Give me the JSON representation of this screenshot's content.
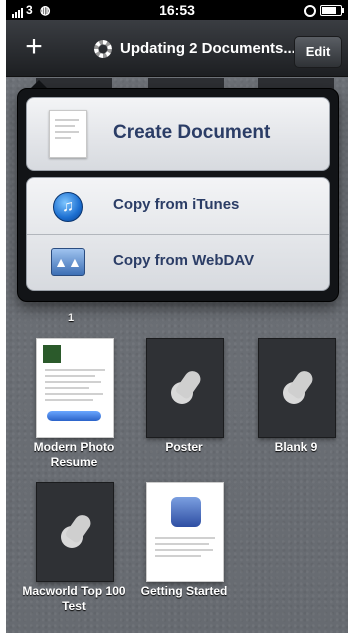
{
  "status_bar": {
    "carrier": "3",
    "time": "16:53"
  },
  "nav": {
    "add_label": "+",
    "title": "Updating 2 Documents...",
    "edit_label": "Edit"
  },
  "menu": {
    "create_document": "Create Document",
    "copy_itunes": "Copy from iTunes",
    "copy_webdav": "Copy from WebDAV"
  },
  "documents": [
    {
      "name": "Modern Photo Resume",
      "icon": "document-thumbnail"
    },
    {
      "name": "Poster",
      "icon": "pages-pen-icon"
    },
    {
      "name": "Blank 9",
      "icon": "pages-pen-icon"
    },
    {
      "name": "Macworld Top 100 Test",
      "icon": "pages-pen-icon"
    },
    {
      "name": "Getting Started",
      "icon": "document-thumbnail"
    }
  ],
  "partially_hidden": {
    "label_fragment": "1"
  },
  "colors": {
    "menu_text": "#2b3d66",
    "nav_bg": "#1d1f22"
  }
}
